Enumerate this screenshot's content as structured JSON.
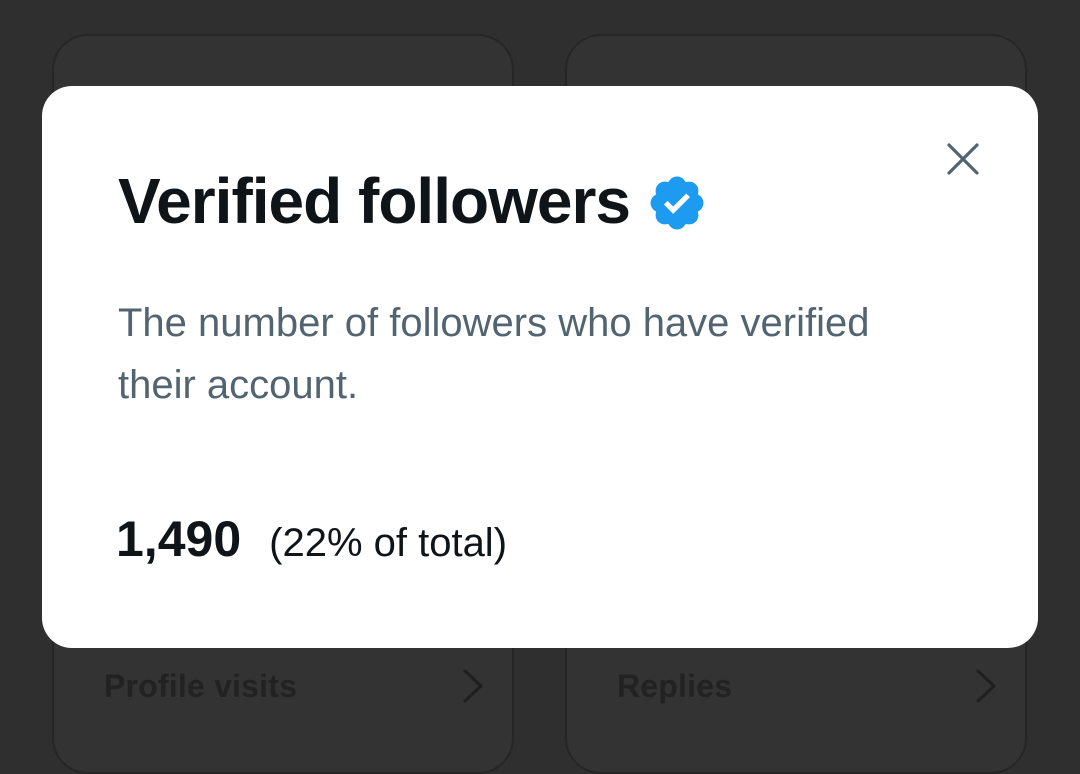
{
  "background": {
    "left_card": {
      "label": "Profile visits",
      "icon": "chevron-right-icon"
    },
    "right_card": {
      "label": "Replies",
      "icon": "chevron-right-icon"
    }
  },
  "modal": {
    "title": "Verified followers",
    "title_icon": "verified-badge-icon",
    "description": "The number of followers who have verified their account.",
    "stat_value": "1,490",
    "stat_note": "(22% of total)",
    "close_icon": "close-icon"
  },
  "colors": {
    "verified_blue": "#1d9bf0",
    "title_text": "#0f1419",
    "secondary_text": "#536471",
    "backdrop": "#2f2f2f"
  }
}
